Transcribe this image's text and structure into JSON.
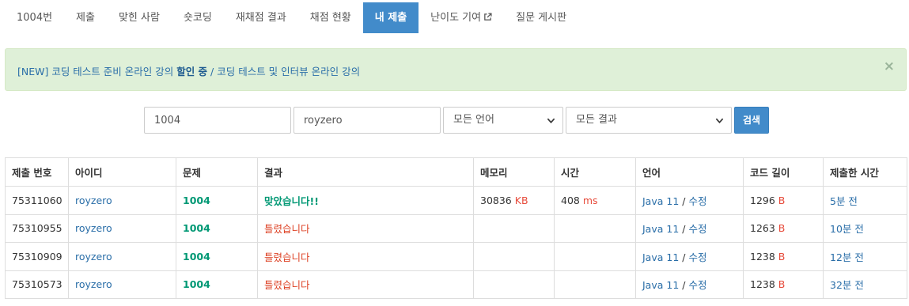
{
  "tabs": [
    {
      "label": "1004번",
      "active": false
    },
    {
      "label": "제출",
      "active": false
    },
    {
      "label": "맞힌 사람",
      "active": false
    },
    {
      "label": "숏코딩",
      "active": false
    },
    {
      "label": "재채점 결과",
      "active": false
    },
    {
      "label": "채점 현황",
      "active": false
    },
    {
      "label": "내 제출",
      "active": true
    },
    {
      "label": "난이도 기여",
      "active": false,
      "icon": "external-link-icon"
    },
    {
      "label": "질문 게시판",
      "active": false
    }
  ],
  "alert": {
    "prefix": "[NEW] 코딩 테스트 준비 온라인 강의 ",
    "bold": "할인 중",
    "suffix": " / 코딩 테스트 및 인터뷰 온라인 강의",
    "close": "×"
  },
  "search": {
    "problem_value": "1004",
    "user_value": "royzero",
    "language_selected": "모든 언어",
    "result_selected": "모든 결과",
    "button_label": "검색"
  },
  "table": {
    "headers": [
      "제출 번호",
      "아이디",
      "문제",
      "결과",
      "메모리",
      "시간",
      "언어",
      "코드 길이",
      "제출한 시간"
    ],
    "rows": [
      {
        "id": "75311060",
        "user": "royzero",
        "problem": "1004",
        "result": "맞았습니다!!",
        "status": "ac",
        "memory": "30836",
        "memory_unit": "KB",
        "time": "408",
        "time_unit": "ms",
        "language": "Java 11",
        "edit": "수정",
        "code_len": "1296",
        "code_unit": "B",
        "submitted": "5분 전"
      },
      {
        "id": "75310955",
        "user": "royzero",
        "problem": "1004",
        "result": "틀렸습니다",
        "status": "wa",
        "memory": "",
        "memory_unit": "",
        "time": "",
        "time_unit": "",
        "language": "Java 11",
        "edit": "수정",
        "code_len": "1263",
        "code_unit": "B",
        "submitted": "10분 전"
      },
      {
        "id": "75310909",
        "user": "royzero",
        "problem": "1004",
        "result": "틀렸습니다",
        "status": "wa",
        "memory": "",
        "memory_unit": "",
        "time": "",
        "time_unit": "",
        "language": "Java 11",
        "edit": "수정",
        "code_len": "1238",
        "code_unit": "B",
        "submitted": "12분 전"
      },
      {
        "id": "75310573",
        "user": "royzero",
        "problem": "1004",
        "result": "틀렸습니다",
        "status": "wa",
        "memory": "",
        "memory_unit": "",
        "time": "",
        "time_unit": "",
        "language": "Java 11",
        "edit": "수정",
        "code_len": "1238",
        "code_unit": "B",
        "submitted": "32분 전"
      }
    ]
  },
  "colors": {
    "tab_active_bg": "#428bca",
    "alert_bg": "#dff0d8",
    "accepted": "#009874",
    "wrong": "#dd4124",
    "link": "#2a6ea8",
    "unit": "#e74c3c"
  }
}
